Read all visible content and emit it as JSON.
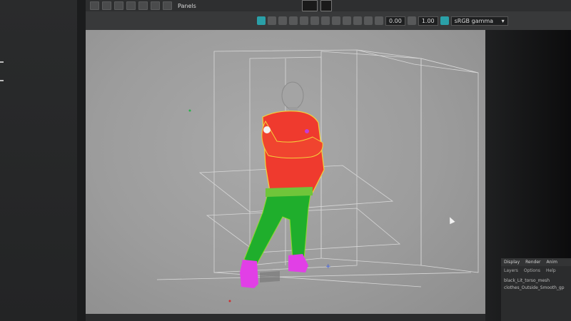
{
  "toolbar": {
    "panels_label": "Panels"
  },
  "panel_bar": {
    "value_a": "0.00",
    "value_b": "1.00",
    "color_space": "sRGB gamma"
  },
  "channel_box": {
    "tabs": [
      "Display",
      "Render",
      "Anim"
    ],
    "menu": [
      "Layers",
      "Options",
      "Help"
    ],
    "rows": [
      "black_Lit_torso_mesh",
      "clothes_Outside_Smooth_gp"
    ]
  },
  "colors": {
    "viewport_bg": "#9e9e9e",
    "shirt": "#ef3a2e",
    "pants": "#1fae2c",
    "shoes": "#e13fe6",
    "skin": "#a9a9a9",
    "accent": "#2aa0a8"
  },
  "icons": [
    "move-tool-icon",
    "rotate-tool-icon",
    "scale-tool-icon",
    "select-tool-icon",
    "camera-icon",
    "grid-icon",
    "wireframe-icon",
    "shaded-icon",
    "lighting-icon",
    "xray-icon"
  ]
}
